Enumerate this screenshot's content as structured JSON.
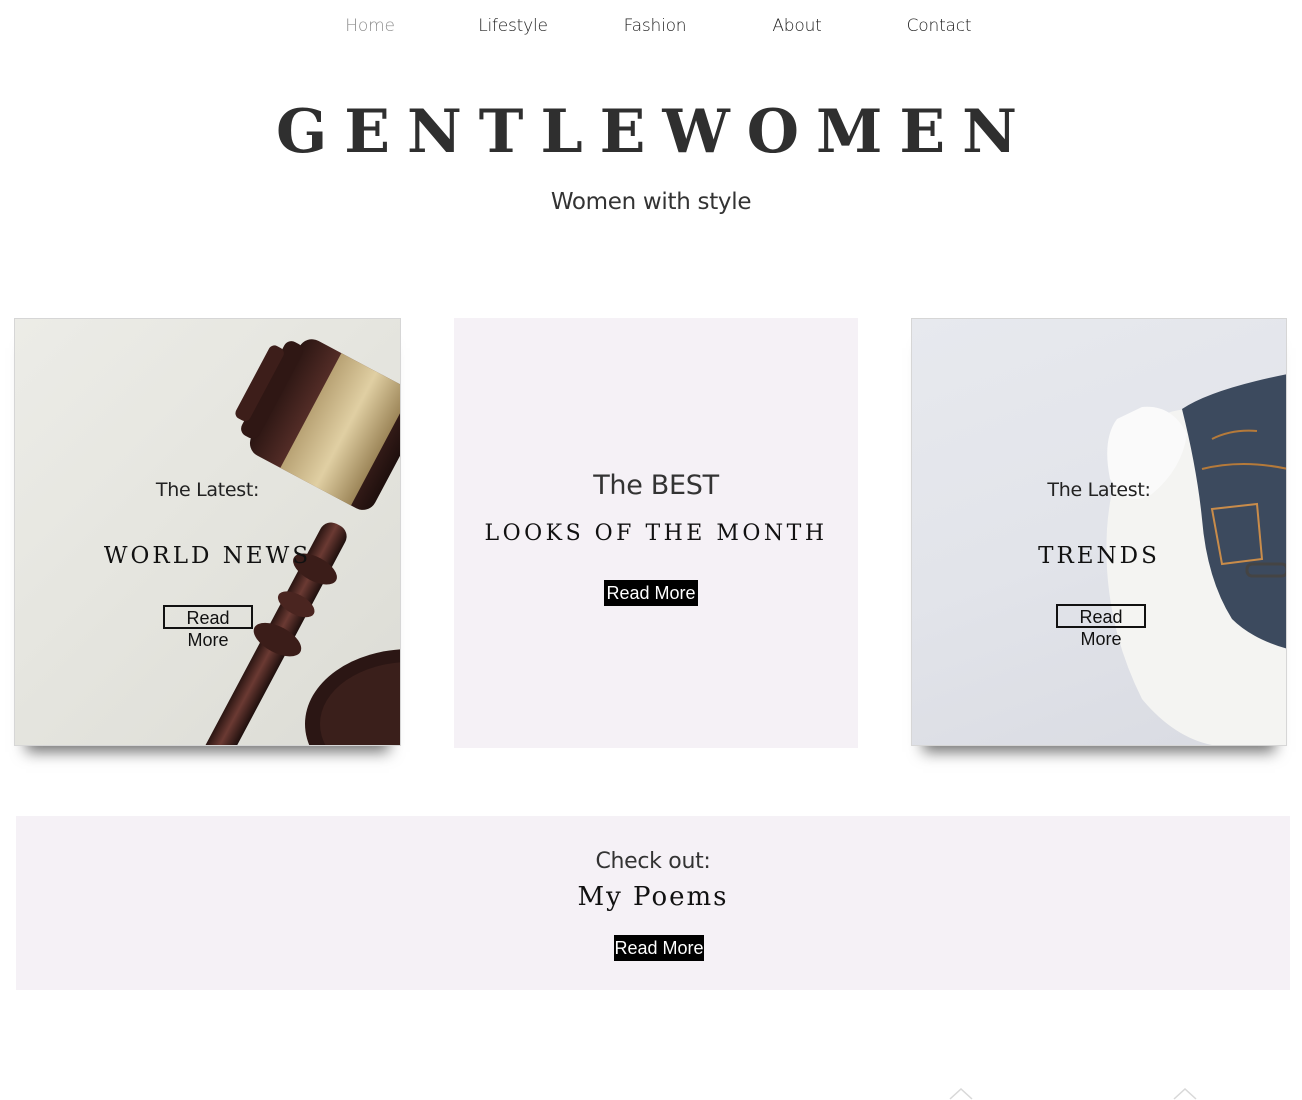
{
  "nav": {
    "items": [
      {
        "label": "Home",
        "active": true
      },
      {
        "label": "Lifestyle",
        "active": false
      },
      {
        "label": "Fashion",
        "active": false
      },
      {
        "label": "About",
        "active": false
      },
      {
        "label": "Contact",
        "active": false
      }
    ]
  },
  "header": {
    "title": "GENTLEWOMEN",
    "tagline": "Women with style"
  },
  "cards": [
    {
      "kicker": "The Latest:",
      "headline": "WORLD NEWS",
      "button": "Read More",
      "image": "gavel-photo"
    },
    {
      "kicker": "The BEST",
      "headline": "LOOKS OF THE MONTH",
      "button": "Read More",
      "background": "#f5f1f6"
    },
    {
      "kicker": "The Latest:",
      "headline": "TRENDS",
      "button": "Read More",
      "image": "jeans-sweater-photo"
    }
  ],
  "poems": {
    "kicker": "Check out:",
    "title": "My Poems",
    "button": "Read More",
    "background": "#f5f1f6"
  },
  "colors": {
    "accent_bg": "#f5f1f6",
    "text": "#222222",
    "nav_active": "#8e8e8e",
    "button_solid": "#000000"
  }
}
